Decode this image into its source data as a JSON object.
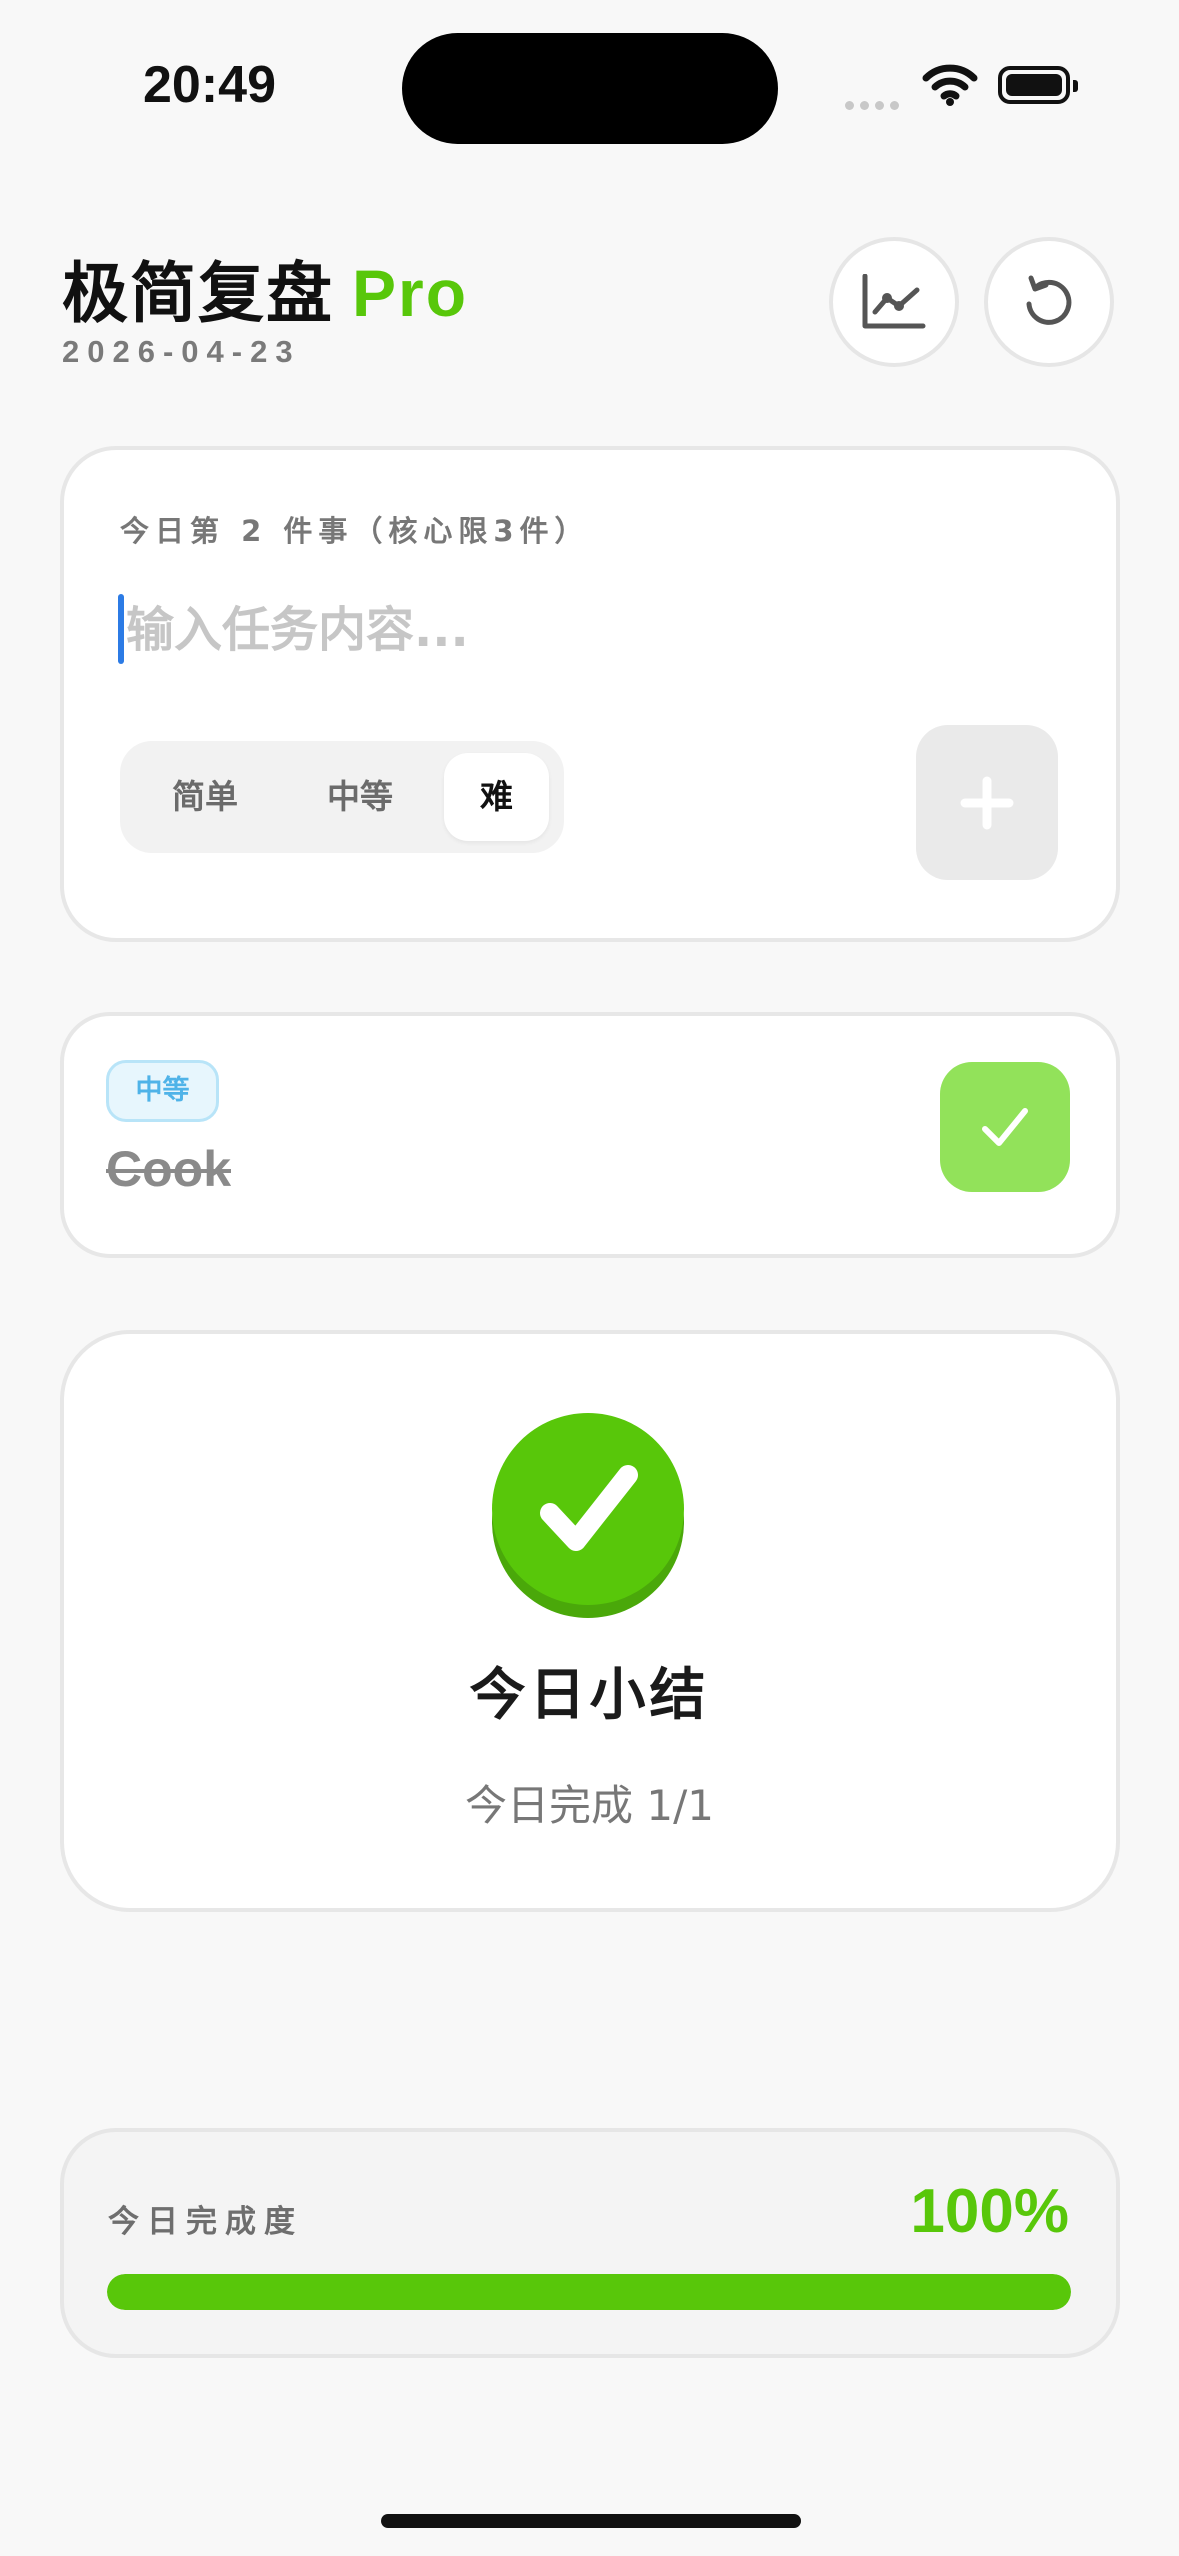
{
  "status_bar": {
    "time": "20:49"
  },
  "header": {
    "title": "极简复盘",
    "title_badge": "Pro",
    "date": "2026-04-23"
  },
  "input_card": {
    "label": "今日第 2 件事（核心限3件）",
    "placeholder": "输入任务内容...",
    "difficulty_options": [
      "简单",
      "中等",
      "难"
    ],
    "selected_difficulty": "难"
  },
  "task": {
    "difficulty": "中等",
    "title": "Cook",
    "completed": true
  },
  "summary": {
    "title": "今日小结",
    "subtitle": "今日完成 1/1"
  },
  "progress": {
    "label": "今日完成度",
    "value_text": "100%",
    "fraction": 1.0
  },
  "colors": {
    "accent_green": "#58c70a",
    "light_green": "#92e25a",
    "badge_blue": "#4fb3e8"
  },
  "icons": [
    "chart-icon",
    "refresh-icon",
    "plus-icon",
    "check-icon",
    "wifi-icon",
    "battery-icon"
  ]
}
